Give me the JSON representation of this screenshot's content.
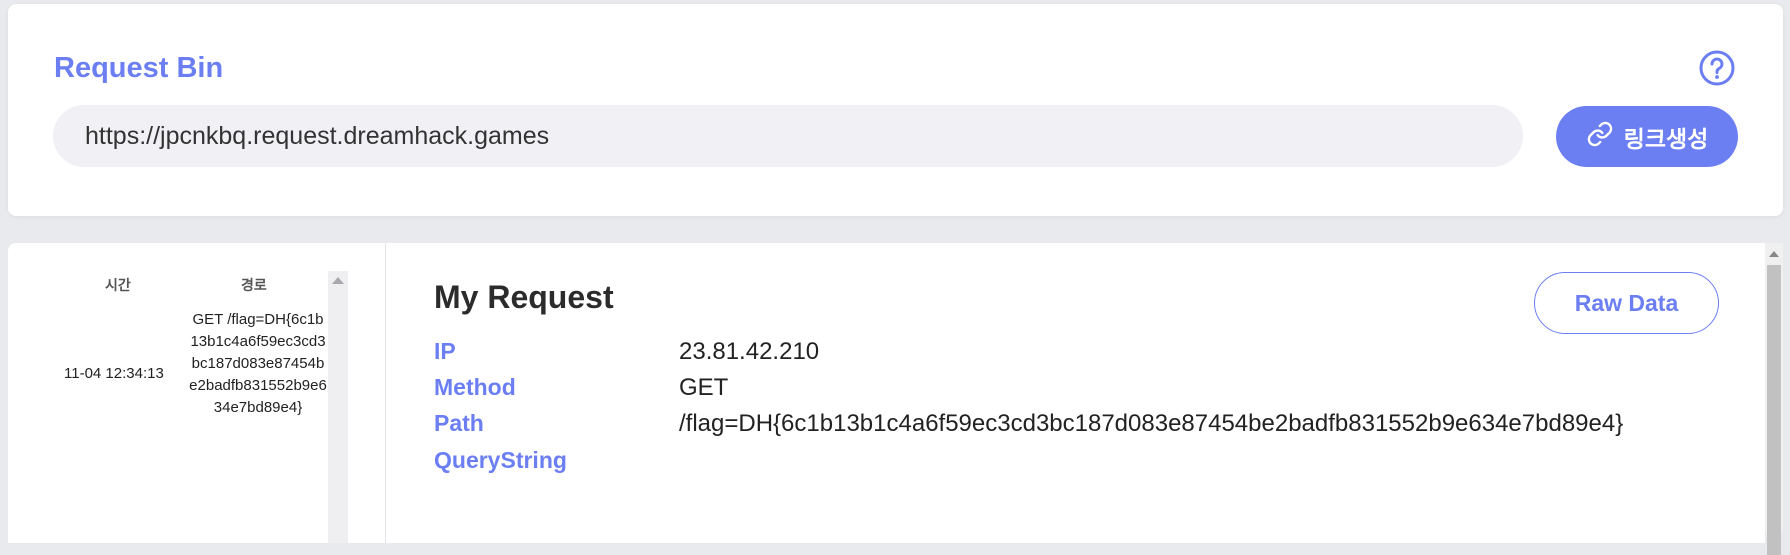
{
  "header": {
    "title": "Request Bin",
    "url": "https://jpcnkbq.request.dreamhack.games",
    "generate_label": "링크생성"
  },
  "request_list": {
    "col_time": "시간",
    "col_path": "경로",
    "rows": [
      {
        "time": "11-04 12:34:13",
        "path": "GET /flag=DH{6c1b13b1c4a6f59ec3cd3bc187d083e87454be2badfb831552b9e634e7bd89e4}"
      }
    ]
  },
  "detail": {
    "title": "My Request",
    "raw_label": "Raw Data",
    "fields": [
      {
        "label": "IP",
        "value": "23.81.42.210"
      },
      {
        "label": "Method",
        "value": "GET"
      },
      {
        "label": "Path",
        "value": "/flag=DH{6c1b13b1c4a6f59ec3cd3bc187d083e87454be2badfb831552b9e634e7bd89e4}"
      },
      {
        "label": "QueryString",
        "value": ""
      }
    ]
  },
  "colors": {
    "accent": "#6b7ef2",
    "background": "#e9eaee",
    "field_bg": "#f0f0f5"
  },
  "icons": [
    "help-icon",
    "link-icon",
    "scroll-up-icon"
  ]
}
